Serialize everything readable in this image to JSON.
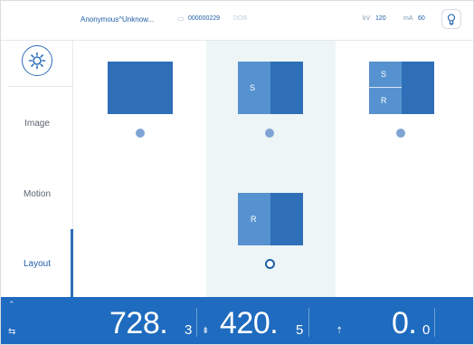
{
  "header": {
    "patient_name": "Anonymous^Unknow...",
    "patient_id": "000000229",
    "dob": "DOB",
    "kv_label": "kV",
    "kv_value": "120",
    "ma_label": "mA",
    "ma_value": "60"
  },
  "sidebar": {
    "items": [
      {
        "label": "Image"
      },
      {
        "label": "Motion"
      },
      {
        "label": "Layout"
      }
    ],
    "active": "Layout"
  },
  "layouts": [
    {
      "name": "single",
      "letters": []
    },
    {
      "name": "split-s",
      "letters": [
        "S"
      ]
    },
    {
      "name": "quad-sr",
      "letters": [
        "S",
        "R"
      ]
    },
    {
      "name": "split-r",
      "letters": [
        "R"
      ],
      "selected": true
    }
  ],
  "bottom_bar": {
    "reading1_main": "728.",
    "reading1_dec": "3",
    "reading2_main": "420.",
    "reading2_dec": "5",
    "reading3_main": "0.",
    "reading3_dec": "0"
  },
  "colors": {
    "accent": "#1e6bbf",
    "tile_dark": "#2e6fb8",
    "tile_light": "#5692cf",
    "highlight_column": "#eef5f6"
  }
}
